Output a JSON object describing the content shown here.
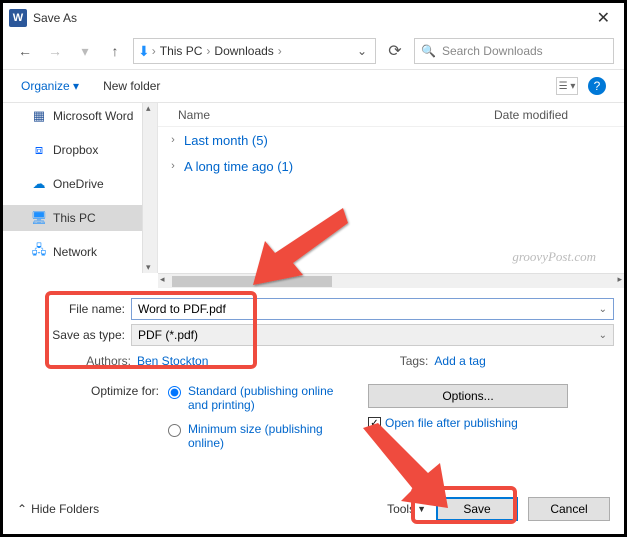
{
  "window": {
    "title": "Save As"
  },
  "breadcrumb": {
    "root": "This PC",
    "folder": "Downloads"
  },
  "search": {
    "placeholder": "Search Downloads"
  },
  "toolbar": {
    "organize": "Organize",
    "new_folder": "New folder"
  },
  "tree": {
    "items": [
      {
        "label": "Microsoft Word",
        "icon": "word"
      },
      {
        "label": "Dropbox",
        "icon": "dropbox"
      },
      {
        "label": "OneDrive",
        "icon": "onedrive"
      },
      {
        "label": "This PC",
        "icon": "pc",
        "selected": true
      },
      {
        "label": "Network",
        "icon": "network"
      }
    ]
  },
  "columns": {
    "name": "Name",
    "date": "Date modified"
  },
  "groups": [
    {
      "label": "Last month (5)"
    },
    {
      "label": "A long time ago (1)"
    }
  ],
  "watermark": "groovyPost.com",
  "form": {
    "filename_label": "File name:",
    "filename_value": "Word to PDF.pdf",
    "type_label": "Save as type:",
    "type_value": "PDF (*.pdf)",
    "authors_label": "Authors:",
    "authors_value": "Ben Stockton",
    "tags_label": "Tags:",
    "tags_value": "Add a tag",
    "optimize_label": "Optimize for:",
    "radio_standard": "Standard (publishing online and printing)",
    "radio_minimum": "Minimum size (publishing online)",
    "options_button": "Options...",
    "open_after": "Open file after publishing"
  },
  "footer": {
    "hide_folders": "Hide Folders",
    "tools": "Tools",
    "save": "Save",
    "cancel": "Cancel"
  }
}
